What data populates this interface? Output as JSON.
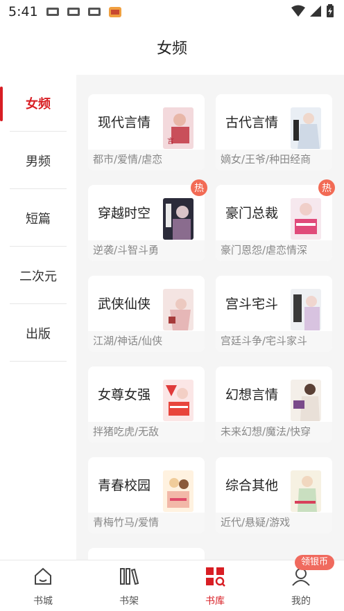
{
  "status_bar": {
    "time": "5:41"
  },
  "header": {
    "title": "女频"
  },
  "sidebar": {
    "items": [
      {
        "label": "女频",
        "active": true
      },
      {
        "label": "男频",
        "active": false
      },
      {
        "label": "短篇",
        "active": false
      },
      {
        "label": "二次元",
        "active": false
      },
      {
        "label": "出版",
        "active": false
      }
    ]
  },
  "categories": [
    {
      "name": "现代言情",
      "tags": "都市/爱情/虐恋",
      "hot": false
    },
    {
      "name": "古代言情",
      "tags": "嫡女/王爷/种田经商",
      "hot": false
    },
    {
      "name": "穿越时空",
      "tags": "逆袭/斗智斗勇",
      "hot": true
    },
    {
      "name": "豪门总裁",
      "tags": "豪门恩怨/虐恋情深",
      "hot": true
    },
    {
      "name": "武侠仙侠",
      "tags": "江湖/神话/仙侠",
      "hot": false
    },
    {
      "name": "宫斗宅斗",
      "tags": "宫廷斗争/宅斗家斗",
      "hot": false
    },
    {
      "name": "女尊女强",
      "tags": "拌猪吃虎/无敌",
      "hot": false
    },
    {
      "name": "幻想言情",
      "tags": "未来幻想/魔法/快穿",
      "hot": false
    },
    {
      "name": "青春校园",
      "tags": "青梅竹马/爱情",
      "hot": false
    },
    {
      "name": "综合其他",
      "tags": "近代/悬疑/游戏",
      "hot": false
    }
  ],
  "hot_badge_label": "热",
  "bottom_nav": {
    "items": [
      {
        "label": "书城"
      },
      {
        "label": "书架"
      },
      {
        "label": "书库"
      },
      {
        "label": "我的"
      }
    ],
    "coin_badge": "领银币"
  },
  "colors": {
    "accent": "#d81e24",
    "badge": "#f26b55",
    "content_bg": "#f5f5f5"
  }
}
